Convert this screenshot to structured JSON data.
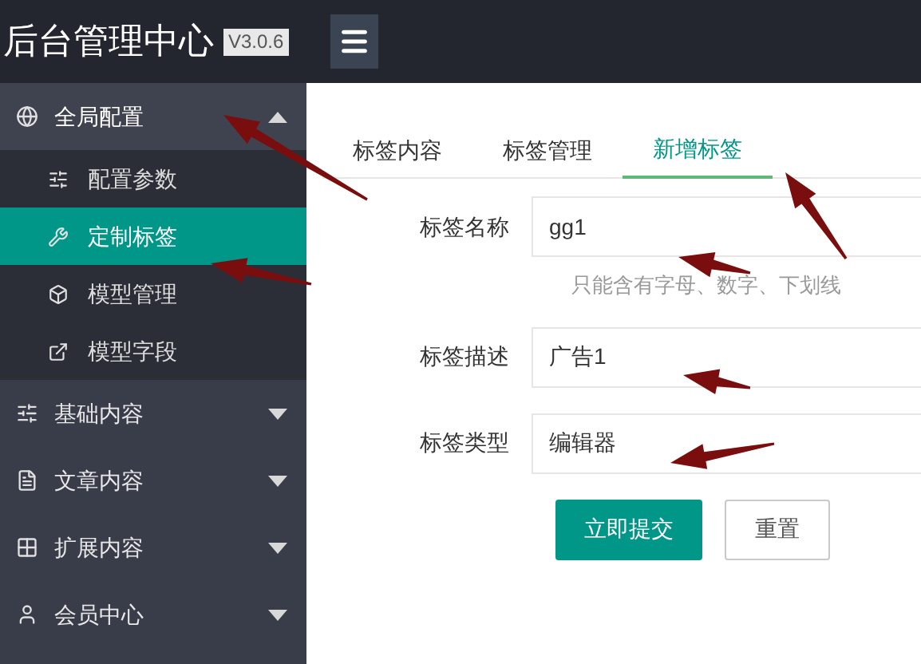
{
  "header": {
    "title": "后台管理中心",
    "version": "V3.0.6"
  },
  "sidebar": {
    "items": [
      {
        "label": "全局配置",
        "expanded": true,
        "children": [
          {
            "label": "配置参数",
            "selected": false
          },
          {
            "label": "定制标签",
            "selected": true
          },
          {
            "label": "模型管理",
            "selected": false
          },
          {
            "label": "模型字段",
            "selected": false
          }
        ]
      },
      {
        "label": "基础内容",
        "expanded": false
      },
      {
        "label": "文章内容",
        "expanded": false
      },
      {
        "label": "扩展内容",
        "expanded": false
      },
      {
        "label": "会员中心",
        "expanded": false
      }
    ]
  },
  "tabs": [
    {
      "label": "标签内容",
      "selected": false
    },
    {
      "label": "标签管理",
      "selected": false
    },
    {
      "label": "新增标签",
      "selected": true
    }
  ],
  "form": {
    "fields": [
      {
        "label": "标签名称",
        "value": "gg1",
        "hint": "只能含有字母、数字、下划线"
      },
      {
        "label": "标签描述",
        "value": "广告1"
      },
      {
        "label": "标签类型",
        "value": "编辑器"
      }
    ],
    "buttons": [
      {
        "label": "立即提交",
        "kind": "primary"
      },
      {
        "label": "重置",
        "kind": "default"
      }
    ]
  }
}
